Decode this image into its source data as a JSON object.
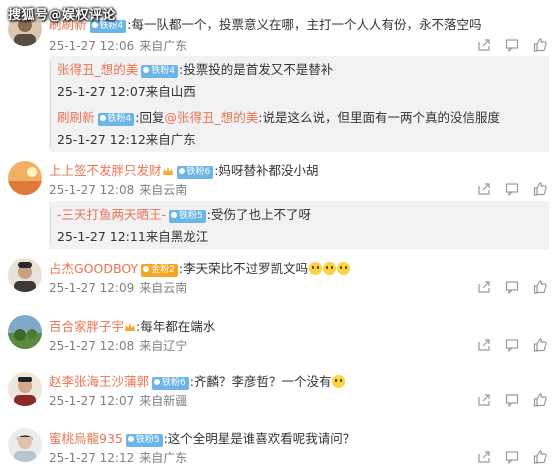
{
  "watermark": "搜狐号@娱权评论",
  "comments": [
    {
      "user": "刷刷新",
      "badge": "铁粉4",
      "text": ":每一队都一个，投票意义在哪，主打一个人人有份，永不落空吗",
      "date": "25-1-27 12:06",
      "location": "来自广东",
      "replies": [
        {
          "user": "张得丑_想的美",
          "badge": "铁粉4",
          "prefix": "",
          "mention": "",
          "text": ":投票投的是首发又不是替补",
          "date": "25-1-27 12:07",
          "location": "来自山西"
        },
        {
          "user": "刷刷新",
          "badge": "铁粉4",
          "prefix": ":回复",
          "mention": "@张得丑_想的美",
          "text": ":说是这么说，但里面有一两个真的没信服度",
          "date": "25-1-27 12:12",
          "location": "来自广东"
        }
      ]
    },
    {
      "user": "上上签不发胖只发财",
      "badge": "铁粉6",
      "text": ":妈呀替补都没小胡",
      "date": "25-1-27 12:08",
      "location": "来自云南",
      "replies": [
        {
          "user": "-三天打鱼两天晒王-",
          "badge": "铁粉5",
          "prefix": "",
          "mention": "",
          "text": ":受伤了也上不了呀",
          "date": "25-1-27 12:11",
          "location": "来自黑龙江"
        }
      ]
    },
    {
      "user": "占杰GOODBOY",
      "badge": "金粉2",
      "text": ":李天荣比不过罗凯文吗",
      "date": "25-1-27 12:09",
      "location": "来自云南",
      "replies": []
    },
    {
      "user": "百合家胖子宇",
      "badge": "",
      "text": ":每年都在端水",
      "date": "25-1-27 12:08",
      "location": "来自辽宁",
      "replies": []
    },
    {
      "user": "赵李张海王沙蒲郭",
      "badge": "铁粉6",
      "text": ":齐麟？李彦哲？一个没有",
      "date": "25-1-27 12:07",
      "location": "来自新疆",
      "replies": []
    },
    {
      "user": "蜜桃烏龍935",
      "badge": "铁粉5",
      "text": ":这个全明星是谁喜欢看呢我请问？",
      "date": "25-1-27 12:12",
      "location": "来自广东",
      "replies": []
    }
  ],
  "colors": {
    "username": "#eb7350",
    "badge_blue": "#6bb5e8",
    "badge_gold": "#f5a623",
    "meta": "#808080",
    "reply_bg": "#f2f2f5"
  },
  "icons": [
    "share-icon",
    "comment-icon",
    "like-icon"
  ]
}
